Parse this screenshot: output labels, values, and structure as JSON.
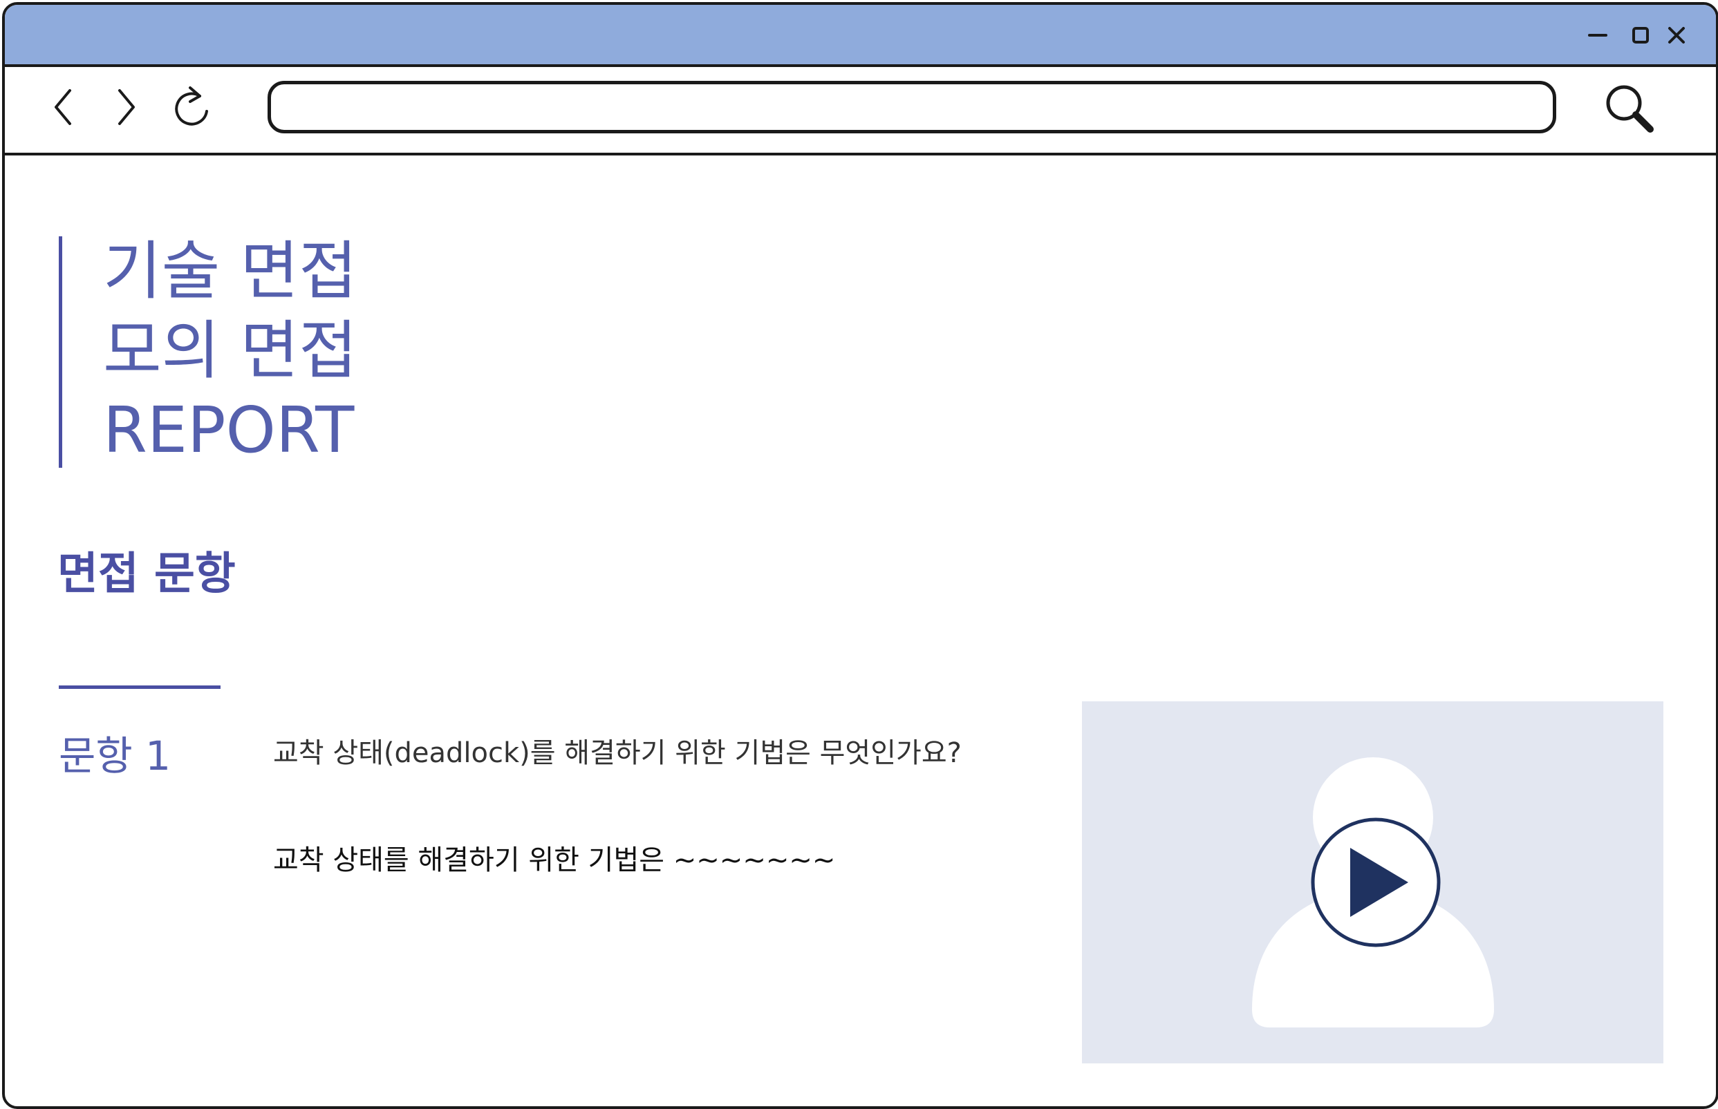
{
  "browser": {
    "controls": {
      "minimize_icon": "minimize-icon",
      "maximize_icon": "maximize-icon",
      "close_icon": "close-icon"
    },
    "nav": {
      "back_icon": "chevron-left-icon",
      "forward_icon": "chevron-right-icon",
      "reload_icon": "reload-icon",
      "search_icon": "search-icon"
    },
    "url_value": "",
    "titlebar_color": "#8fabdc"
  },
  "report": {
    "title_lines": [
      "기술 면접",
      "모의 면접",
      "REPORT"
    ],
    "accent_color": "#4a4fa3"
  },
  "section": {
    "title": "면접 문항"
  },
  "question": {
    "label": "문항 1",
    "text": "교착 상태(deadlock)를 해결하기 위한 기법은 무엇인가요?",
    "answer": "교착 상태를 해결하기 위한 기법은 ~~~~~~~"
  },
  "video": {
    "background": "#e3e7f1",
    "avatar_icon": "person-icon",
    "play_icon": "play-icon",
    "play_color": "#1f3260"
  }
}
